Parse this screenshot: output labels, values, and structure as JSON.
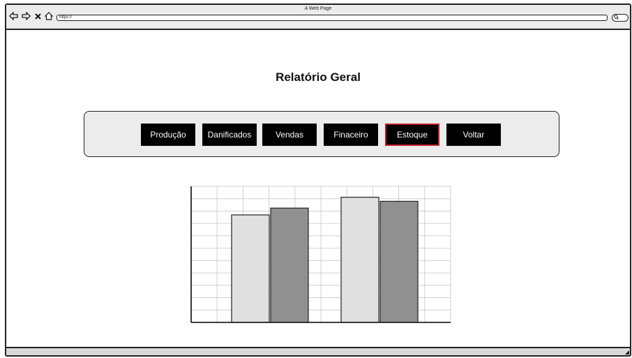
{
  "window": {
    "title": "A Web Page"
  },
  "browser": {
    "url": "https://",
    "search_icon": "search-icon",
    "nav_icons": [
      "back-arrow-icon",
      "forward-arrow-icon",
      "close-icon",
      "home-icon"
    ]
  },
  "page": {
    "heading": "Relatório Geral"
  },
  "menu": {
    "buttons": [
      {
        "label": "Produção"
      },
      {
        "label": "Danificados"
      },
      {
        "label": "Vendas"
      },
      {
        "label": "Finaceiro"
      },
      {
        "label": "Estoque",
        "active": true
      },
      {
        "label": "Voltar"
      }
    ],
    "active_color": "#c0202a"
  },
  "chart_data": {
    "type": "bar",
    "categories": [
      "",
      ""
    ],
    "series": [
      {
        "values": [
          0.79
        ],
        "color": "#e0e0e0"
      },
      {
        "values": [
          0.84
        ],
        "color": "#909090"
      }
    ],
    "groups": [
      {
        "values": [
          0.79,
          0.84
        ]
      },
      {
        "values": [
          0.92,
          0.89
        ]
      }
    ],
    "ylim": [
      0,
      1
    ],
    "grid": true
  }
}
